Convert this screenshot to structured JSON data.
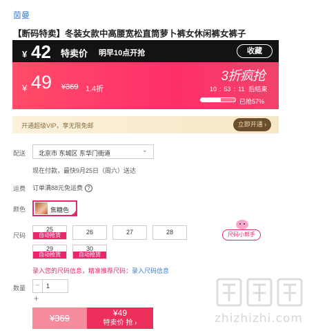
{
  "brand": "茵曼",
  "product_title": "【断码特卖】冬装女款中高腰宽松直筒萝卜裤女休闲裤女裤子",
  "promo_bar": {
    "currency": "¥",
    "special_price": "42",
    "special_label": "特卖价",
    "schedule": "明早10点开抢",
    "favorite_label": "收藏"
  },
  "price_panel": {
    "currency": "¥",
    "current_price": "49",
    "original_price": "369",
    "discount": "1.4折",
    "flash_label": "3折疯抢",
    "countdown": {
      "h": "10",
      "sep1": ":",
      "m": "53",
      "sep2": ":",
      "s": "11",
      "suffix": "后结束"
    },
    "progress_percent": 57,
    "progress_text": "已抢57%"
  },
  "vip": {
    "text": "开通超级VIP，享无限免邮",
    "button": "立即开通",
    "button_arrow": "›"
  },
  "delivery": {
    "label": "配送",
    "address": "北京市 东城区 东华门街道",
    "chevron": "⌄",
    "eta": "现在付款，最快9月25日（周六）送达"
  },
  "shipping": {
    "label": "运费",
    "text": "订单满88元免运费",
    "help": "?"
  },
  "color": {
    "label": "颜色",
    "selected": "焦糖色",
    "check": "✓"
  },
  "size": {
    "label": "尺码",
    "row1": [
      {
        "value": "25",
        "tag": "自动抢货"
      },
      {
        "value": "26"
      },
      {
        "value": "27"
      },
      {
        "value": "28"
      }
    ],
    "row2": [
      {
        "value": "29",
        "tag": "自动抢货"
      },
      {
        "value": "30",
        "tag": "自动抢货"
      }
    ],
    "helper": "尺码小帮手"
  },
  "measure": {
    "prefix": "录入您的尺码信息，精准推荐尺码：",
    "link": "录入尺码信息"
  },
  "quantity": {
    "label": "数量",
    "minus": "−",
    "value": "1",
    "plus": "+"
  },
  "buy": {
    "original": "¥369",
    "price": "¥49",
    "label": "特卖价 抢 ›"
  },
  "watermark": {
    "text": "zhizhizhi.com"
  },
  "colors": {
    "accent": "#ec2f5b",
    "link": "#3d7fd2",
    "dark_bar": "#131313",
    "vip_bg": "#fbf1dc"
  }
}
